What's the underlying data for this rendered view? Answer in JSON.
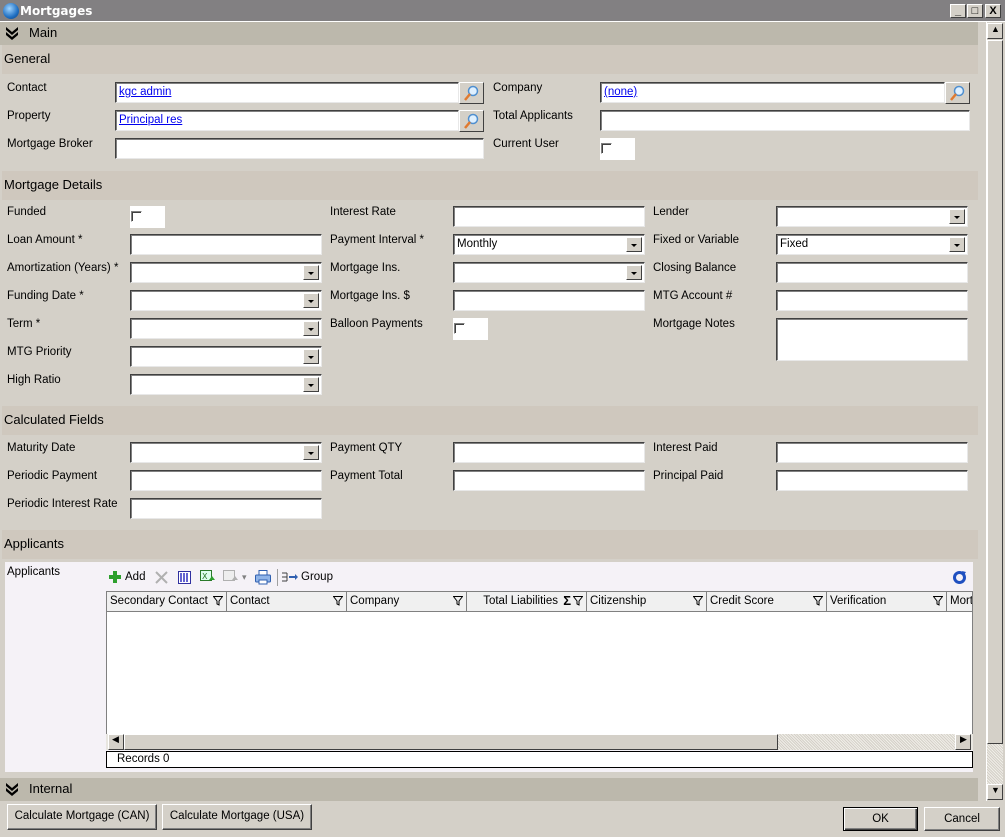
{
  "window": {
    "title": "Mortgages",
    "controls": {
      "minimize": "_",
      "maximize": "□",
      "close": "X"
    }
  },
  "groups": {
    "main": "Main",
    "internal": "Internal"
  },
  "sections": {
    "general": {
      "title": "General",
      "contact_label": "Contact",
      "contact_value": "kgc admin",
      "property_label": "Property",
      "property_value": "Principal res",
      "broker_label": "Mortgage Broker",
      "broker_value": "",
      "company_label": "Company",
      "company_value": "(none)",
      "total_applicants_label": "Total Applicants",
      "total_applicants_value": "",
      "current_user_label": "Current User",
      "current_user_checked": false
    },
    "details": {
      "title": "Mortgage Details",
      "funded_label": "Funded",
      "funded_checked": false,
      "loan_amount_label": "Loan Amount *",
      "loan_amount_value": "",
      "amortization_label": "Amortization (Years) *",
      "amortization_value": "",
      "funding_date_label": "Funding Date *",
      "funding_date_value": "",
      "term_label": "Term *",
      "term_value": "",
      "mtg_priority_label": "MTG Priority",
      "mtg_priority_value": "",
      "high_ratio_label": "High Ratio",
      "high_ratio_value": "",
      "interest_rate_label": "Interest Rate",
      "interest_rate_value": "",
      "payment_interval_label": "Payment Interval *",
      "payment_interval_value": "Monthly",
      "mortgage_ins_label": "Mortgage Ins.",
      "mortgage_ins_value": "",
      "mortgage_ins_amt_label": "Mortgage Ins. $",
      "mortgage_ins_amt_value": "",
      "balloon_label": "Balloon Payments",
      "balloon_checked": false,
      "lender_label": "Lender",
      "lender_value": "",
      "fixed_variable_label": "Fixed or Variable",
      "fixed_variable_value": "Fixed",
      "closing_balance_label": "Closing Balance",
      "closing_balance_value": "",
      "mtg_account_label": "MTG Account #",
      "mtg_account_value": "",
      "notes_label": "Mortgage Notes",
      "notes_value": ""
    },
    "calculated": {
      "title": "Calculated Fields",
      "maturity_date_label": "Maturity Date",
      "maturity_date_value": "",
      "periodic_payment_label": "Periodic Payment",
      "periodic_payment_value": "",
      "periodic_rate_label": "Periodic Interest Rate",
      "periodic_rate_value": "",
      "payment_qty_label": "Payment QTY",
      "payment_qty_value": "",
      "payment_total_label": "Payment Total",
      "payment_total_value": "",
      "interest_paid_label": "Interest Paid",
      "interest_paid_value": "",
      "principal_paid_label": "Principal Paid",
      "principal_paid_value": ""
    },
    "applicants": {
      "title": "Applicants",
      "grid_label": "Applicants",
      "toolbar": {
        "add": "Add",
        "group": "Group"
      },
      "columns": [
        "Secondary Contact",
        "Contact",
        "Company",
        "Total Liabilities",
        "Citizenship",
        "Credit Score",
        "Verification",
        "Mortg"
      ],
      "rows": [],
      "records_text": "Records 0"
    }
  },
  "footer": {
    "calc_can": "Calculate Mortgage (CAN)",
    "calc_usa": "Calculate Mortgage (USA)",
    "ok": "OK",
    "cancel": "Cancel"
  }
}
